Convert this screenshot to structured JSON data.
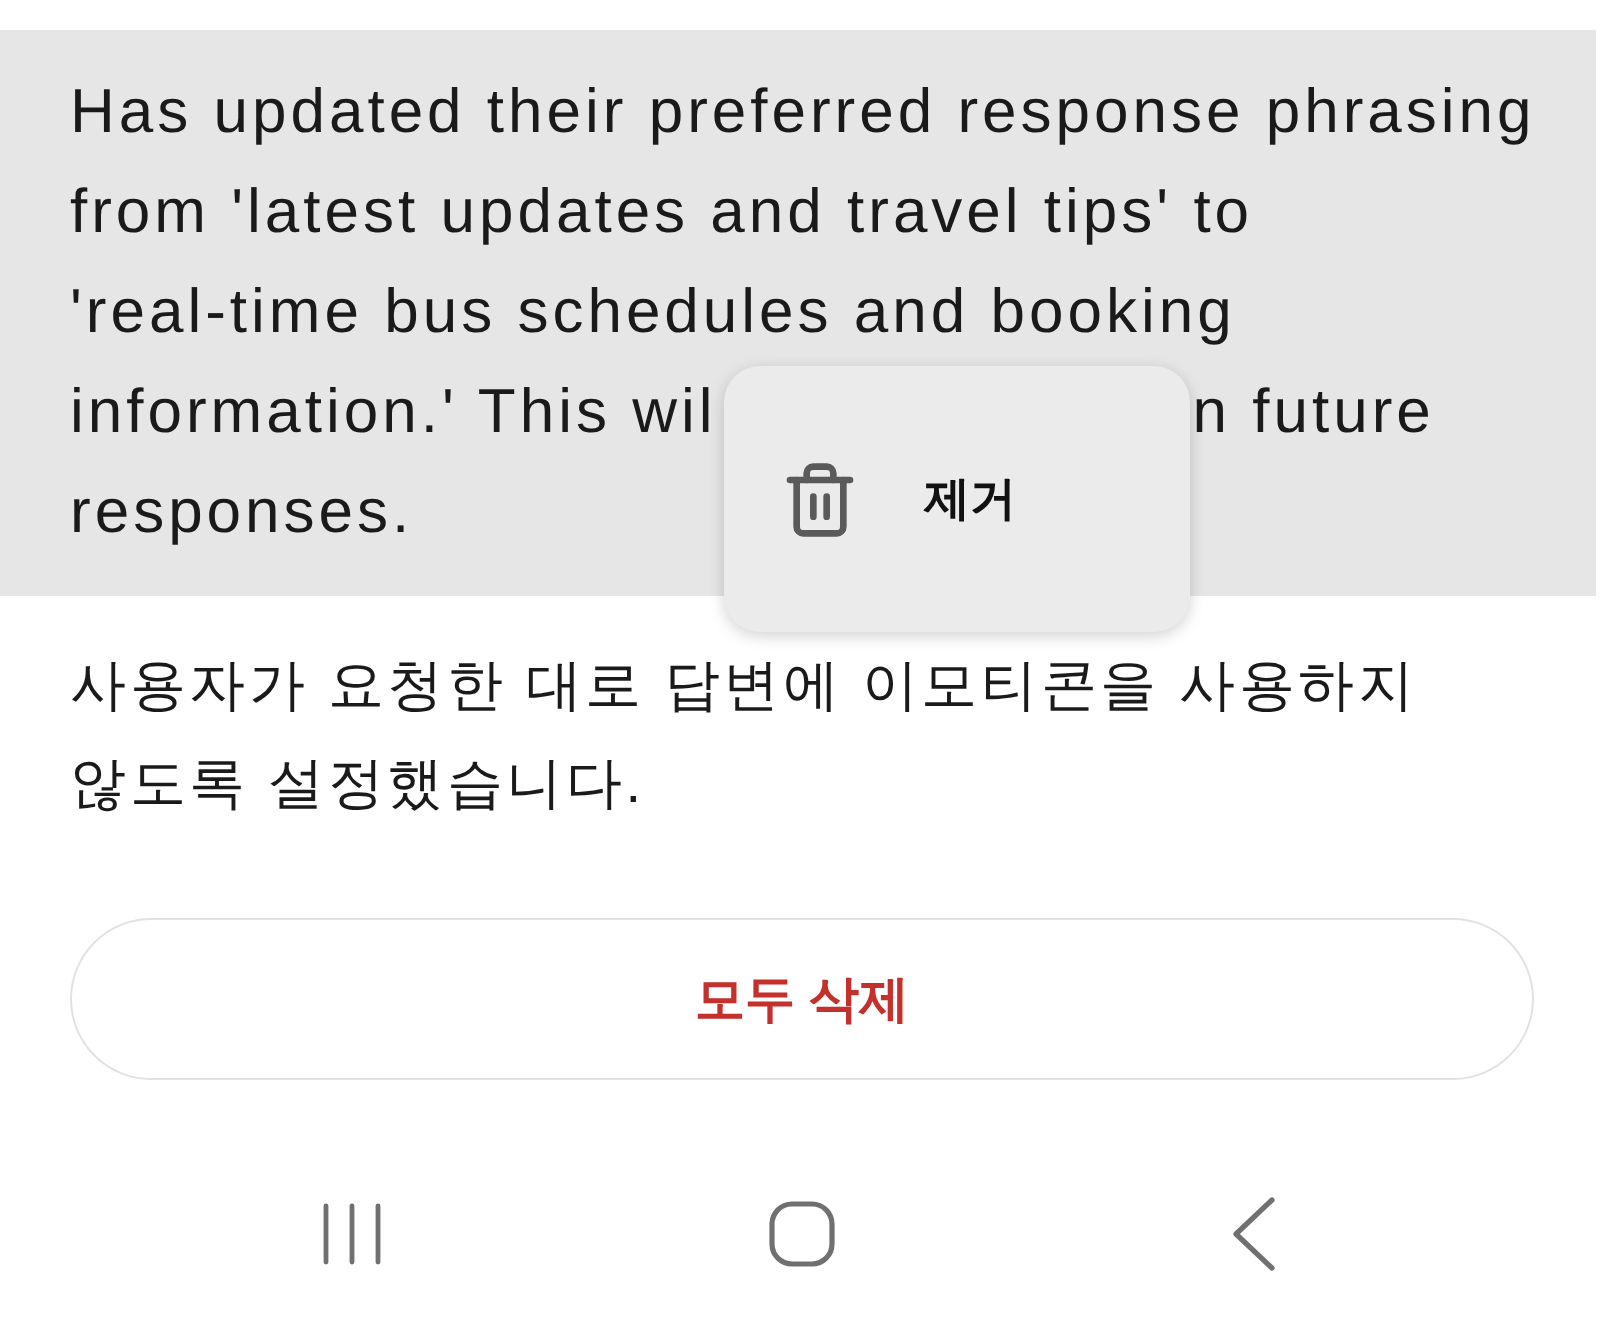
{
  "memories": [
    {
      "lines": [
        "Has updated their preferred response phrasing",
        "from 'latest updates and travel tips' to",
        "'real-time bus schedules and booking",
        "information.' This wil"
      ],
      "lines_after_menu": [
        "n future",
        "responses."
      ],
      "selected": true
    },
    {
      "lines": [
        "사용자가 요청한 대로 답변에 이모티콘을 사용하지",
        "않도록 설정했습니다."
      ],
      "selected": false
    }
  ],
  "context_menu": {
    "items": [
      {
        "kind": "delete",
        "label": "제거"
      }
    ]
  },
  "delete_all_button": {
    "label": "모두 삭제"
  }
}
